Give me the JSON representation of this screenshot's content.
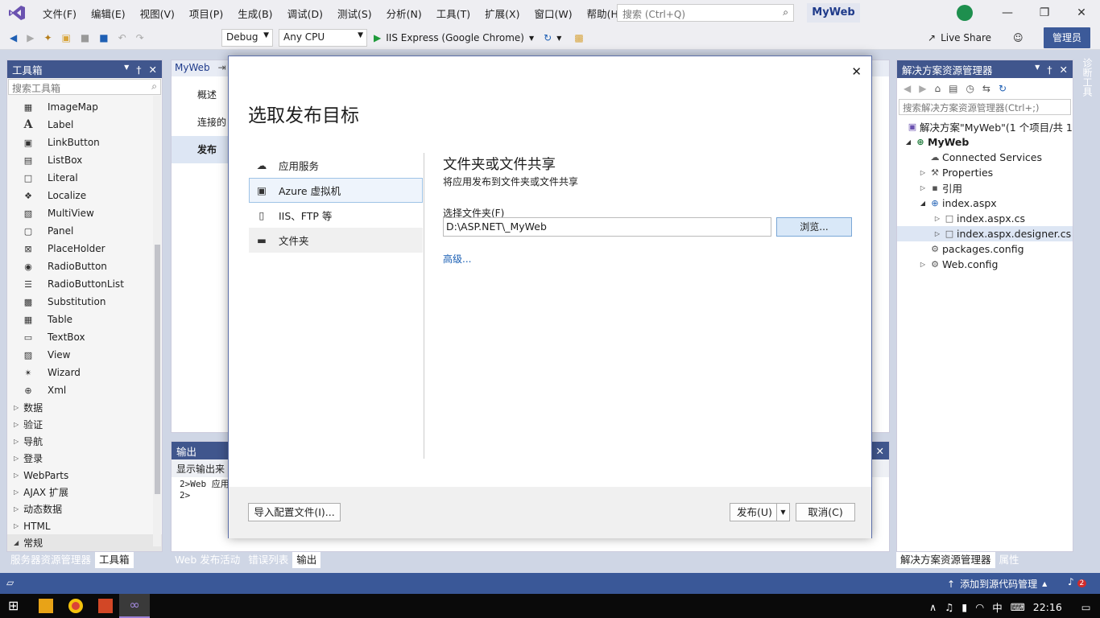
{
  "titlebar": {
    "menu": [
      "文件(F)",
      "编辑(E)",
      "视图(V)",
      "项目(P)",
      "生成(B)",
      "调试(D)",
      "测试(S)",
      "分析(N)",
      "工具(T)",
      "扩展(X)",
      "窗口(W)",
      "帮助(H)"
    ],
    "search_placeholder": "搜索 (Ctrl+Q)",
    "project_name": "MyWeb"
  },
  "toolbar": {
    "config": "Debug",
    "platform": "Any CPU",
    "run_target": "IIS Express (Google Chrome)",
    "live_share": "Live Share",
    "admin": "管理员"
  },
  "toolbox": {
    "title": "工具箱",
    "search_placeholder": "搜索工具箱",
    "items": [
      "ImageMap",
      "Label",
      "LinkButton",
      "ListBox",
      "Literal",
      "Localize",
      "MultiView",
      "Panel",
      "PlaceHolder",
      "RadioButton",
      "RadioButtonList",
      "Substitution",
      "Table",
      "TextBox",
      "View",
      "Wizard",
      "Xml"
    ],
    "groups": [
      "数据",
      "验证",
      "导航",
      "登录",
      "WebParts",
      "AJAX 扩展",
      "动态数据",
      "HTML",
      "常规"
    ],
    "tabs": [
      "服务器资源管理器",
      "工具箱"
    ]
  },
  "document": {
    "tab": "MyWeb",
    "nav": [
      "概述",
      "连接的",
      "发布"
    ]
  },
  "output": {
    "title": "输出",
    "source_label": "显示输出来",
    "lines": [
      "2>Web 应用",
      "2>"
    ],
    "tabs": [
      "Web 发布活动",
      "错误列表",
      "输出"
    ]
  },
  "solution_explorer": {
    "title": "解决方案资源管理器",
    "search_placeholder": "搜索解决方案资源管理器(Ctrl+;)",
    "solution": "解决方案\"MyWeb\"(1 个项目/共 1",
    "project": "MyWeb",
    "nodes": [
      "Connected Services",
      "Properties",
      "引用",
      "index.aspx",
      "index.aspx.cs",
      "index.aspx.designer.cs",
      "packages.config",
      "Web.config"
    ],
    "tabs": [
      "解决方案资源管理器",
      "属性"
    ],
    "side_tab": "诊断工具"
  },
  "dialog": {
    "title": "选取发布目标",
    "targets": [
      "应用服务",
      "Azure 虚拟机",
      "IIS、FTP 等",
      "文件夹"
    ],
    "pane_title": "文件夹或文件共享",
    "pane_desc": "将应用发布到文件夹或文件共享",
    "folder_label": "选择文件夹(F)",
    "folder_value": "D:\\ASP.NET\\_MyWeb",
    "browse": "浏览...",
    "advanced": "高级...",
    "import": "导入配置文件(I)...",
    "publish": "发布(U)",
    "cancel": "取消(C)"
  },
  "statusbar": {
    "source_control": "添加到源代码管理",
    "notifications": "2"
  },
  "taskbar": {
    "time": "22:16",
    "ime": "中"
  }
}
